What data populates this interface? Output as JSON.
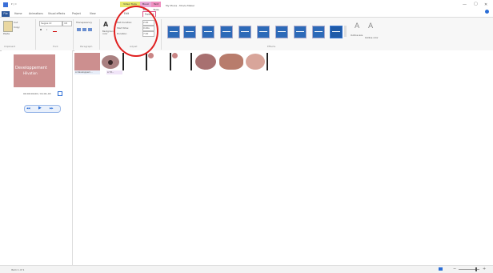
{
  "window": {
    "title": "My Movie - Movie Maker",
    "quick_access": "▾ | =",
    "minimize": "—",
    "maximize": "▢",
    "close": "✕"
  },
  "context_tabs": {
    "video_tools": "Video Tools",
    "music_tools": "Music Tools",
    "text_tools": "Text Tools",
    "edit": "Edit",
    "format": "Format"
  },
  "ribbon_tabs": [
    "File",
    "Home",
    "Animations",
    "Visual effects",
    "Project",
    "View"
  ],
  "ribbon": {
    "clipboard": {
      "paste": "Paste",
      "cut": "Cut",
      "copy": "Copy",
      "label": "Clipboard"
    },
    "font": {
      "family": "Segoe UI",
      "size": "18",
      "bold": "B",
      "italic": "I",
      "label": "Font"
    },
    "paragraph": {
      "transparency": "Transparency",
      "label": "Paragraph"
    },
    "adjust": {
      "bg_color": "Background color",
      "label": "Adjust"
    },
    "text_items": [
      "Text duration:",
      "Start time:",
      "Duration:"
    ],
    "text_values": [
      "2.00",
      "0.00s",
      "7.00"
    ],
    "effects_label": "Effects",
    "outline_size": "Outline size",
    "outline_color": "Outline color"
  },
  "preview": {
    "title_line1": "Developpement",
    "title_line2": "Hilvation",
    "time": "00:00:00.00 / 01:01.43",
    "play": "▶",
    "prev": "◀◀",
    "next": "▶▶"
  },
  "timeline": {
    "captions": [
      "A Développem...",
      "A Tit..."
    ]
  },
  "status": {
    "items": "Item 1 of 1",
    "zoom_minus": "−",
    "zoom_plus": "+"
  },
  "colors": {
    "accent": "#2b579a",
    "highlight": "#e02020",
    "preview_bg": "#cc8f8f"
  }
}
